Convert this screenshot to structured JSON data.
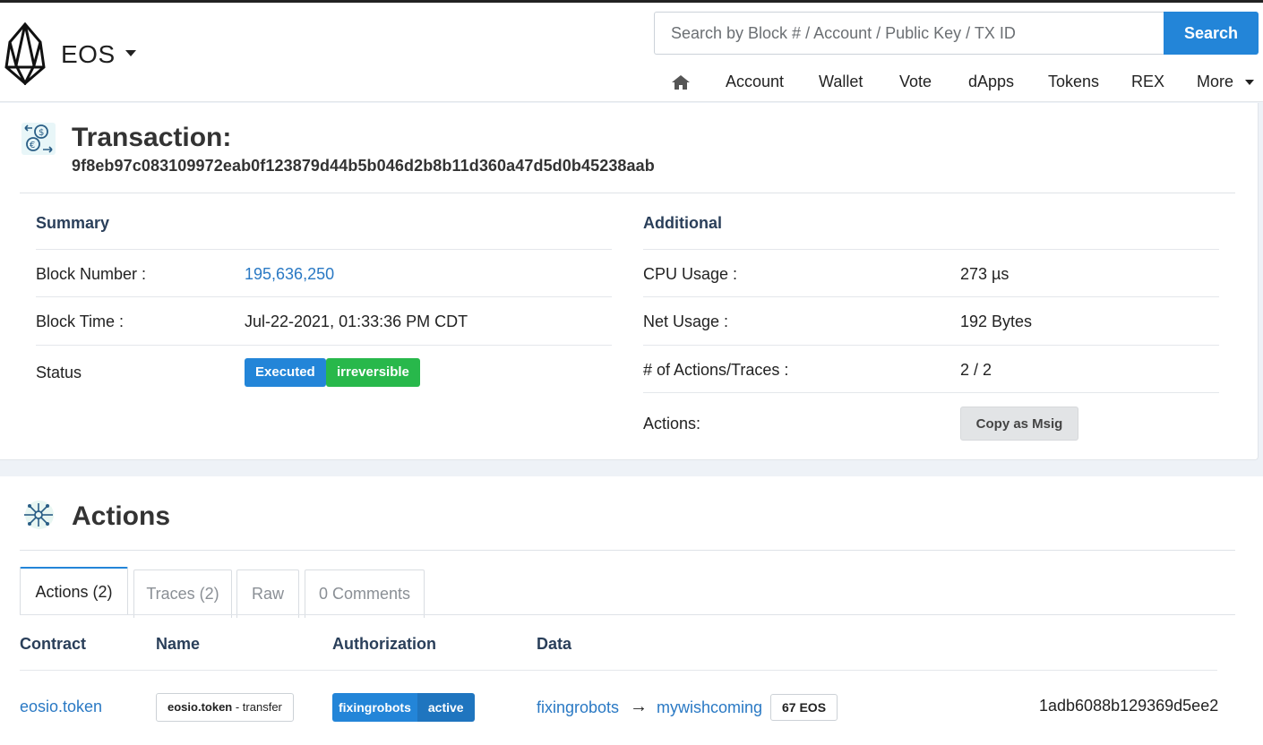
{
  "header": {
    "brand": "EOS",
    "search_placeholder": "Search by Block # / Account / Public Key / TX ID",
    "search_button": "Search",
    "nav": [
      "Account",
      "Wallet",
      "Vote",
      "dApps",
      "Tokens",
      "REX",
      "More"
    ]
  },
  "transaction": {
    "title": "Transaction:",
    "hash": "9f8eb97c083109972eab0f123879d44b5b046d2b8b11d360a47d5d0b45238aab",
    "summary": {
      "heading": "Summary",
      "block_number_label": "Block Number :",
      "block_number": "195,636,250",
      "block_time_label": "Block Time :",
      "block_time": "Jul-22-2021, 01:33:36 PM CDT",
      "status_label": "Status",
      "status_executed": "Executed",
      "status_irreversible": "irreversible"
    },
    "additional": {
      "heading": "Additional",
      "cpu_label": "CPU Usage :",
      "cpu": "273 µs",
      "net_label": "Net Usage :",
      "net": "192 Bytes",
      "actions_traces_label": "# of Actions/Traces :",
      "actions_traces": "2 / 2",
      "actions_label": "Actions:",
      "copy_button": "Copy as Msig"
    }
  },
  "actions": {
    "title": "Actions",
    "tabs": [
      "Actions (2)",
      "Traces (2)",
      "Raw",
      "0 Comments"
    ],
    "columns": [
      "Contract",
      "Name",
      "Authorization",
      "Data"
    ],
    "rows": [
      {
        "contract": "eosio.token",
        "name_bold": "eosio.token",
        "name_rest": " - transfer",
        "auth_actor": "fixingrobots",
        "auth_perm": "active",
        "from": "fixingrobots",
        "arrow": "→",
        "to": "mywishcoming",
        "amount": "67 EOS",
        "memo": "1adb6088b129369d5ee2"
      }
    ]
  },
  "colors": {
    "accent": "#2385d8",
    "success": "#28b84b",
    "link": "#2a79c4",
    "heading": "#2a3f5a"
  }
}
